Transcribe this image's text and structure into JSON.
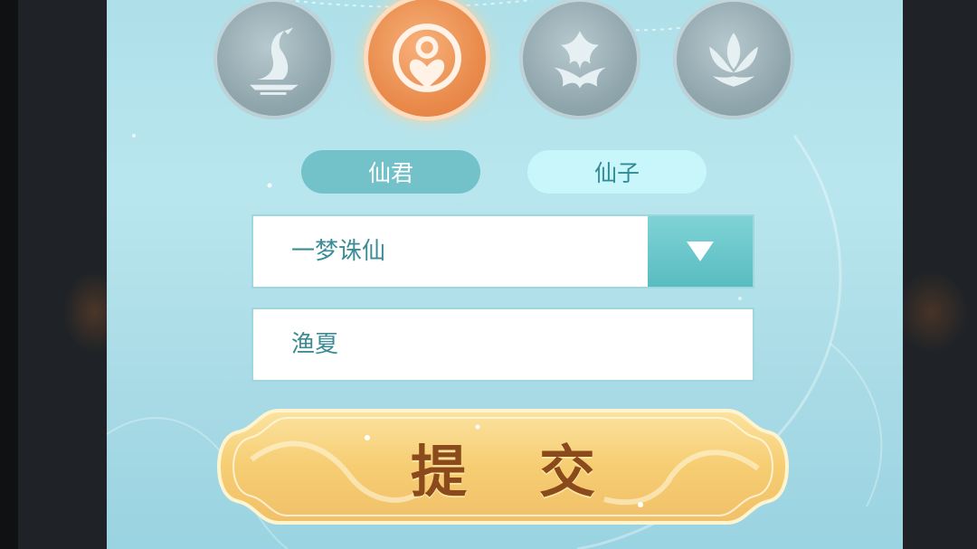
{
  "emblems": [
    {
      "name": "crane-emblem",
      "active": false
    },
    {
      "name": "heart-person-emblem",
      "active": true
    },
    {
      "name": "ornament-emblem",
      "active": false
    },
    {
      "name": "lotus-emblem",
      "active": false
    }
  ],
  "gender": {
    "option_male": "仙君",
    "option_female": "仙子",
    "selected": "仙君"
  },
  "server_select": {
    "value": "一梦诛仙",
    "arrow_icon": "triangle-down-icon"
  },
  "name_input": {
    "value": "渔夏"
  },
  "submit": {
    "label": "提交"
  },
  "colors": {
    "accent_teal": "#74c2c9",
    "active_orange": "#e98a4b",
    "button_gold": "#f7d07a",
    "text_teal": "#3b8c95",
    "button_text": "#8a4a1c"
  }
}
